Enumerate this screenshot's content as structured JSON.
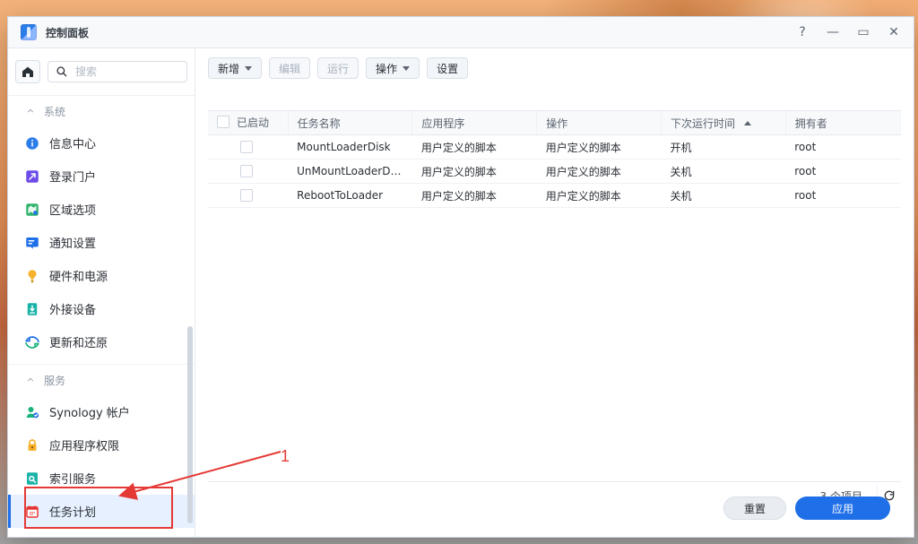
{
  "colors": {
    "accent": "#1f6fe8",
    "annotation": "#e53935"
  },
  "window": {
    "title": "控制面板",
    "controls": {
      "help": "?",
      "minimize": "—",
      "maximize": "▭",
      "close": "✕"
    }
  },
  "sidebar": {
    "search_placeholder": "搜索",
    "sections": [
      {
        "title": "系统",
        "items": [
          {
            "label": "信息中心",
            "icon": "info-icon"
          },
          {
            "label": "登录门户",
            "icon": "portal-icon"
          },
          {
            "label": "区域选项",
            "icon": "region-icon"
          },
          {
            "label": "通知设置",
            "icon": "notification-icon"
          },
          {
            "label": "硬件和电源",
            "icon": "hardware-power-icon"
          },
          {
            "label": "外接设备",
            "icon": "external-device-icon"
          },
          {
            "label": "更新和还原",
            "icon": "update-restore-icon"
          }
        ]
      },
      {
        "title": "服务",
        "items": [
          {
            "label": "Synology 帐户",
            "icon": "synology-account-icon"
          },
          {
            "label": "应用程序权限",
            "icon": "lock-icon"
          },
          {
            "label": "索引服务",
            "icon": "index-service-icon"
          },
          {
            "label": "任务计划",
            "icon": "calendar-icon"
          }
        ]
      }
    ]
  },
  "toolbar": {
    "create_label": "新增",
    "edit_label": "编辑",
    "run_label": "运行",
    "action_label": "操作",
    "settings_label": "设置"
  },
  "table": {
    "columns": [
      "已启动",
      "任务名称",
      "应用程序",
      "操作",
      "下次运行时间",
      "拥有者"
    ],
    "rows": [
      {
        "enabled": false,
        "task_name": "MountLoaderDisk",
        "application": "用户定义的脚本",
        "action": "用户定义的脚本",
        "next_run": "开机",
        "owner": "root"
      },
      {
        "enabled": false,
        "task_name": "UnMountLoaderDisk",
        "application": "用户定义的脚本",
        "action": "用户定义的脚本",
        "next_run": "关机",
        "owner": "root"
      },
      {
        "enabled": false,
        "task_name": "RebootToLoader",
        "application": "用户定义的脚本",
        "action": "用户定义的脚本",
        "next_run": "关机",
        "owner": "root"
      }
    ],
    "item_count_text": "3 个项目"
  },
  "footer": {
    "reset_label": "重置",
    "apply_label": "应用"
  },
  "annotation": {
    "label": "1"
  }
}
